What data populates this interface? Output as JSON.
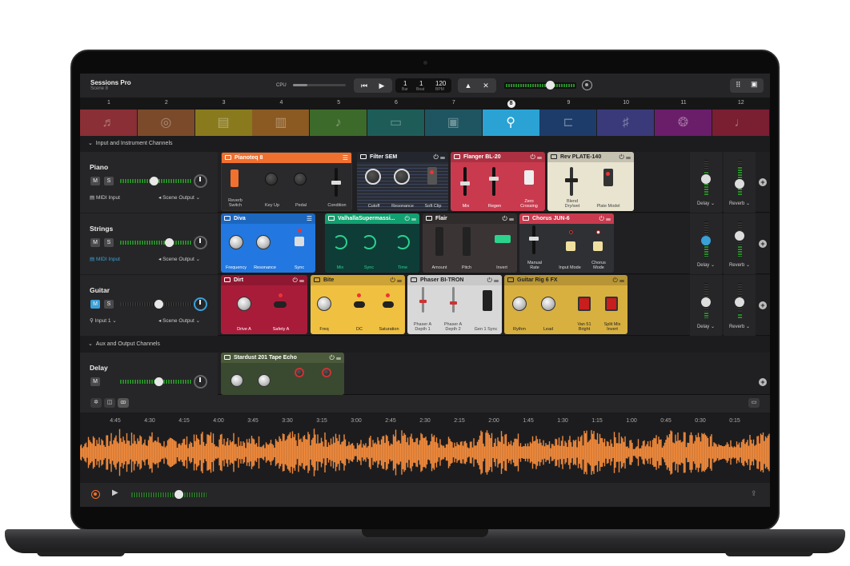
{
  "app": {
    "name": "Sessions Pro",
    "scene": "Scene 8"
  },
  "toolbar": {
    "cpu": "CPU",
    "bar": "1",
    "beat": "1",
    "bar_label": "Bar",
    "beat_label": "Beat",
    "tempo": "120",
    "tempo_label": "BPM",
    "cpu_load": 0.27
  },
  "scenes": [
    "1",
    "2",
    "3",
    "4",
    "5",
    "6",
    "7",
    "8",
    "9",
    "10",
    "11",
    "12"
  ],
  "scene_tiles": [
    {
      "icon": "piano-icon",
      "color": "#8a2f35"
    },
    {
      "icon": "drums-icon",
      "color": "#7a4a2a"
    },
    {
      "icon": "synth-icon",
      "color": "#8a7a1e"
    },
    {
      "icon": "amp-icon",
      "color": "#8a5a22"
    },
    {
      "icon": "guitar-icon",
      "color": "#3c6a2a"
    },
    {
      "icon": "keyboard-icon",
      "color": "#1e5c58"
    },
    {
      "icon": "tape-icon",
      "color": "#1e5560"
    },
    {
      "icon": "microphone-icon",
      "color": "#2aa3d4"
    },
    {
      "icon": "trumpet-icon",
      "color": "#1e3c6a"
    },
    {
      "icon": "violin-icon",
      "color": "#3a3a7a"
    },
    {
      "icon": "tambourine-icon",
      "color": "#6a1e6a"
    },
    {
      "icon": "electric-guitar-icon",
      "color": "#7a1e32"
    }
  ],
  "sections": {
    "input": "Input and Instrument Channels",
    "aux": "Aux and Output Channels"
  },
  "channels": {
    "piano": {
      "name": "Piano",
      "mute": "M",
      "solo": "S",
      "input": "MIDI Input",
      "output": "Scene Output"
    },
    "strings": {
      "name": "Strings",
      "mute": "M",
      "solo": "S",
      "input": "MIDI Input",
      "output": "Scene Output"
    },
    "guitar": {
      "name": "Guitar",
      "mute": "M",
      "solo": "S",
      "input": "Input 1",
      "output": "Scene Output"
    },
    "delay": {
      "name": "Delay",
      "mute": "M"
    }
  },
  "plugins": {
    "pianoteq": {
      "name": "Pianoteq 8",
      "labels": [
        "Reverb Switch",
        "Key Up",
        "Pedal",
        "Condition"
      ]
    },
    "filtersem": {
      "name": "Filter SEM",
      "labels": [
        "Cutoff",
        "Resonance",
        "Soft Clip"
      ]
    },
    "flanger": {
      "name": "Flanger BL-20",
      "labels": [
        "Mix",
        "Regen",
        "Zero Crossing"
      ]
    },
    "rev": {
      "name": "Rev PLATE-140",
      "labels": [
        "Blend Dry/wet",
        "Plate Model"
      ]
    },
    "diva": {
      "name": "Diva",
      "labels": [
        "Frequency",
        "Resonance",
        "Sync"
      ]
    },
    "valhalla": {
      "name": "ValhallaSupermassi...",
      "labels": [
        "Mix",
        "Sync",
        "Time"
      ]
    },
    "flair": {
      "name": "Flair",
      "labels": [
        "Amount",
        "Pitch",
        "Invert"
      ]
    },
    "chorus": {
      "name": "Chorus JUN-6",
      "labels": [
        "Manual Rate",
        "Input Mode",
        "Chorus Mode"
      ]
    },
    "dirt": {
      "name": "Dirt",
      "labels": [
        "Drive A",
        "Safety A"
      ]
    },
    "bite": {
      "name": "Bite",
      "labels": [
        "Freq",
        "DC",
        "Saturation"
      ]
    },
    "phaser": {
      "name": "Phaser BI-TRON",
      "labels": [
        "Phaser A Depth 1",
        "Phaser A Depth 2",
        "Gen 1 Sync"
      ]
    },
    "guitarrig": {
      "name": "Guitar Rig 6 FX",
      "labels": [
        "Rythm",
        "Lead",
        "Van 51 Bright",
        "Split Mix Invert"
      ]
    },
    "stardust": {
      "name": "Stardust 201 Tape Echo"
    }
  },
  "sends": {
    "delay": "Delay",
    "reverb": "Reverb"
  },
  "timeline": [
    "4:45",
    "4:30",
    "4:15",
    "4:00",
    "3:45",
    "3:30",
    "3:15",
    "3:00",
    "2:45",
    "2:30",
    "2:15",
    "2:00",
    "1:45",
    "1:30",
    "1:15",
    "1:00",
    "0:45",
    "0:30",
    "0:15"
  ],
  "colors": {
    "accent": "#3aa0d8",
    "waveform": "#f08a3c"
  }
}
